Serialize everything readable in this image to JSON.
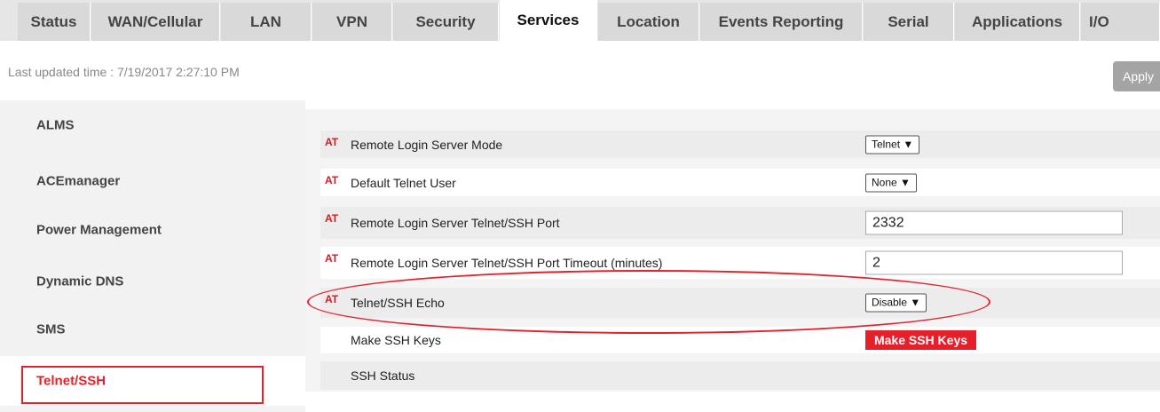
{
  "tabs": [
    {
      "label": "Status"
    },
    {
      "label": "WAN/Cellular"
    },
    {
      "label": "LAN"
    },
    {
      "label": "VPN"
    },
    {
      "label": "Security"
    },
    {
      "label": "Services"
    },
    {
      "label": "Location"
    },
    {
      "label": "Events Reporting"
    },
    {
      "label": "Serial"
    },
    {
      "label": "Applications"
    },
    {
      "label": "I/O"
    }
  ],
  "active_tab": "Services",
  "last_updated": "Last updated time : 7/19/2017 2:27:10 PM",
  "apply_label": "Apply",
  "sidebar": {
    "items": [
      {
        "label": "ALMS"
      },
      {
        "label": "ACEmanager"
      },
      {
        "label": "Power Management"
      },
      {
        "label": "Dynamic DNS"
      },
      {
        "label": "SMS"
      },
      {
        "label": "Telnet/SSH"
      }
    ],
    "active": "Telnet/SSH"
  },
  "settings": {
    "at_marker": "AT",
    "remote_login_mode": {
      "label": "Remote Login Server Mode",
      "value": "Telnet ▼"
    },
    "default_telnet_user": {
      "label": "Default Telnet User",
      "value": "None ▼"
    },
    "telnet_ssh_port": {
      "label": "Remote Login Server Telnet/SSH Port",
      "value": "2332"
    },
    "port_timeout": {
      "label": "Remote Login Server Telnet/SSH Port Timeout (minutes)",
      "value": "2"
    },
    "telnet_ssh_echo": {
      "label": "Telnet/SSH Echo",
      "value": "Disable ▼"
    },
    "make_ssh_keys": {
      "label": "Make SSH Keys",
      "button": "Make SSH Keys"
    },
    "ssh_status": {
      "label": "SSH Status",
      "value": ""
    }
  },
  "colors": {
    "accent": "#e5202a",
    "at_marker": "#d71920"
  }
}
